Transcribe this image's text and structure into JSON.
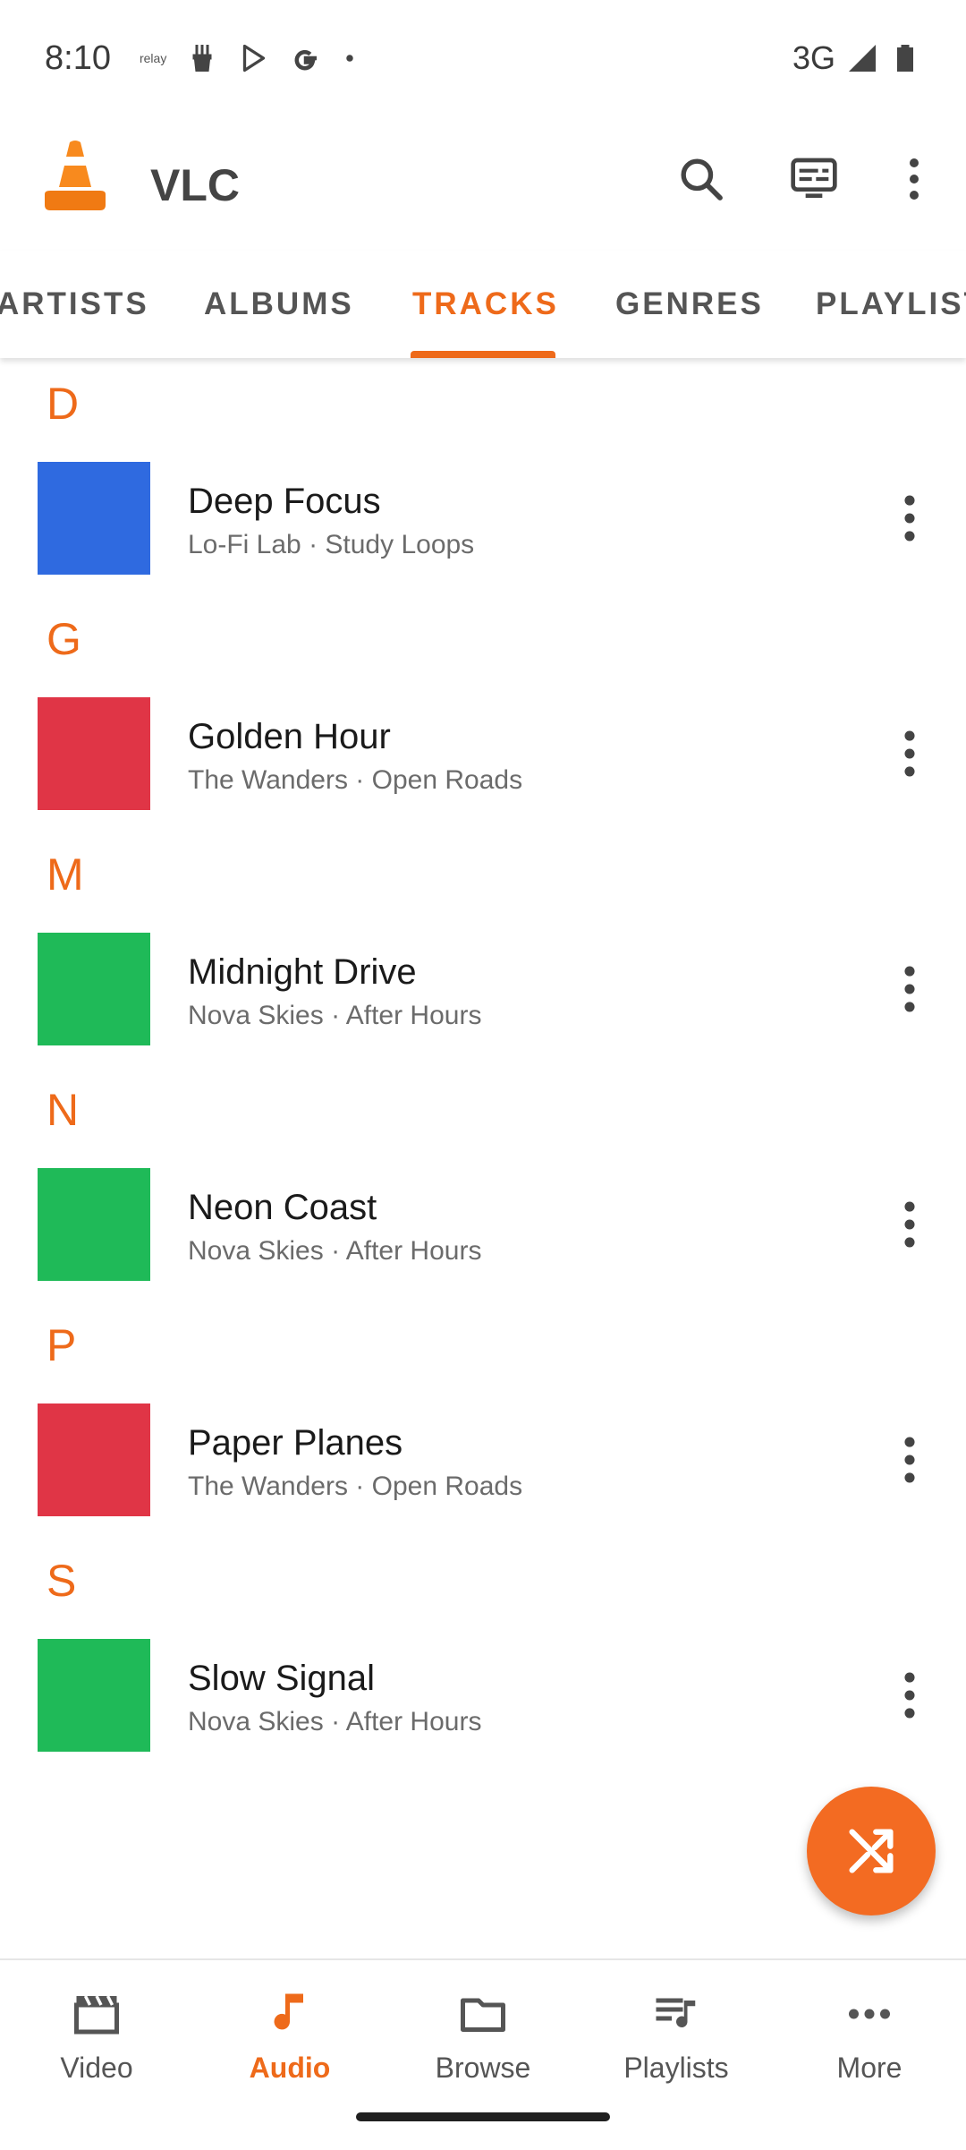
{
  "status_bar": {
    "time": "8:10",
    "relay_label": "relay",
    "network": "3G",
    "icons": [
      "amazon-relay-icon",
      "brush-icon",
      "play-store-icon",
      "google-icon",
      "dot-icon",
      "signal-icon",
      "battery-icon"
    ]
  },
  "toolbar": {
    "app_title": "VLC",
    "icons": [
      "vlc-cone-logo",
      "search-icon",
      "rendering-icon",
      "overflow-menu-icon"
    ]
  },
  "tabs": [
    {
      "label": "ARTISTS",
      "active": false
    },
    {
      "label": "ALBUMS",
      "active": false
    },
    {
      "label": "TRACKS",
      "active": true
    },
    {
      "label": "GENRES",
      "active": false
    },
    {
      "label": "PLAYLISTS",
      "active": false
    }
  ],
  "accent_color": "#ee6a1a",
  "sections": [
    {
      "letter": "D",
      "track": {
        "title": "Deep Focus",
        "subtitle": "Lo-Fi Lab · Study Loops",
        "color": "#2f6ae0"
      }
    },
    {
      "letter": "G",
      "track": {
        "title": "Golden Hour",
        "subtitle": "The Wanders · Open Roads",
        "color": "#e03546"
      }
    },
    {
      "letter": "M",
      "track": {
        "title": "Midnight Drive",
        "subtitle": "Nova Skies · After Hours",
        "color": "#1fba58"
      }
    },
    {
      "letter": "N",
      "track": {
        "title": "Neon Coast",
        "subtitle": "Nova Skies · After Hours",
        "color": "#1fba58"
      }
    },
    {
      "letter": "P",
      "track": {
        "title": "Paper Planes",
        "subtitle": "The Wanders · Open Roads",
        "color": "#e03546"
      }
    },
    {
      "letter": "S",
      "track": {
        "title": "Slow Signal",
        "subtitle": "Nova Skies · After Hours",
        "color": "#1fba58"
      }
    }
  ],
  "fab": {
    "icon": "shuffle-icon"
  },
  "bottom_nav": [
    {
      "label": "Video",
      "icon": "movie-icon",
      "active": false
    },
    {
      "label": "Audio",
      "icon": "music-note-icon",
      "active": true
    },
    {
      "label": "Browse",
      "icon": "folder-icon",
      "active": false
    },
    {
      "label": "Playlists",
      "icon": "playlist-icon",
      "active": false
    },
    {
      "label": "More",
      "icon": "more-horiz-icon",
      "active": false
    }
  ]
}
